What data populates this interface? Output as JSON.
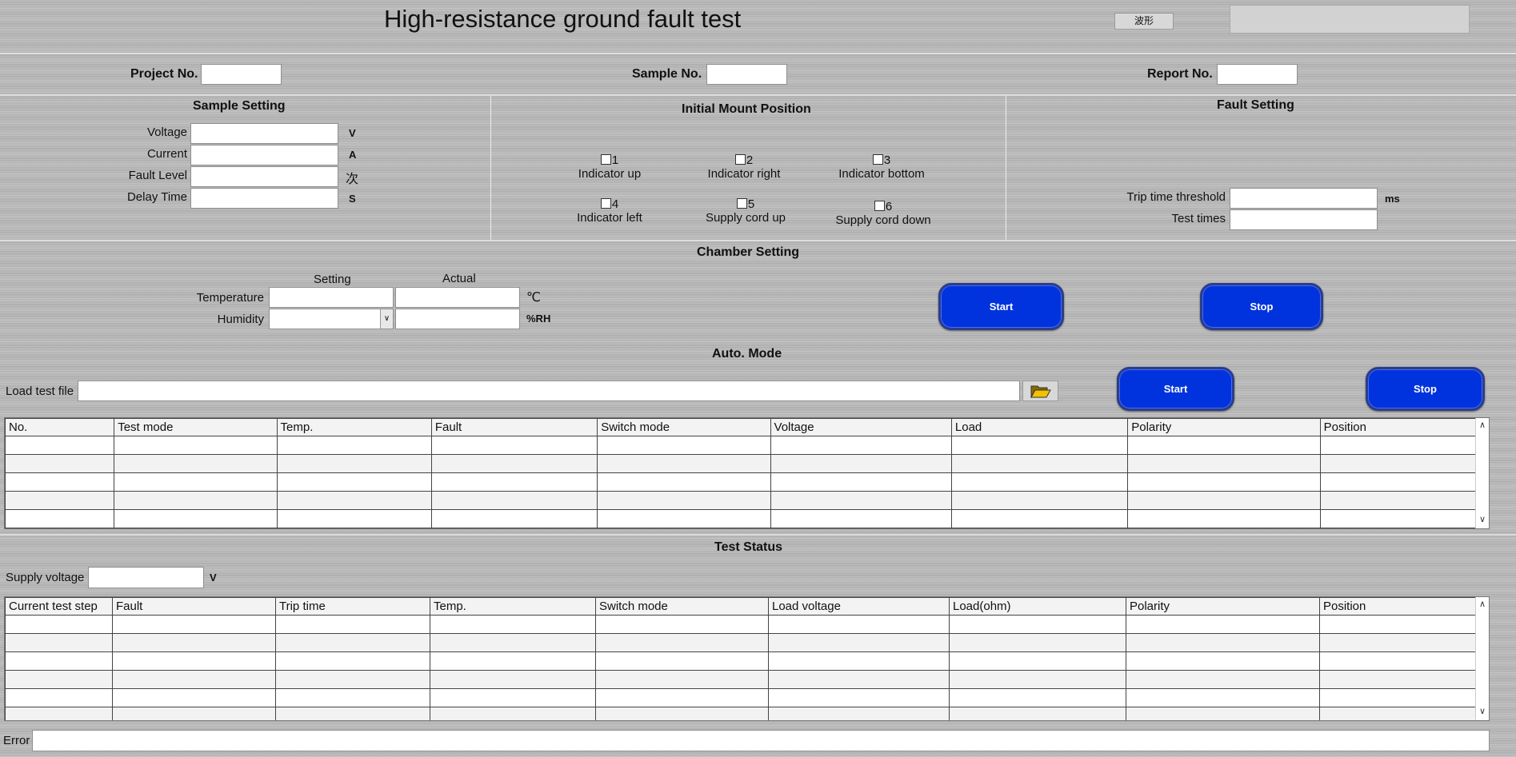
{
  "header": {
    "title": "High-resistance ground fault test",
    "wave_button_label": "波形"
  },
  "info": {
    "project_label": "Project No.",
    "sample_label": "Sample No.",
    "report_label": "Report No."
  },
  "sample_setting": {
    "title": "Sample Setting",
    "voltage_label": "Voltage",
    "voltage_unit": "V",
    "current_label": "Current",
    "current_unit": "A",
    "fault_level_label": "Fault Level",
    "fault_level_unit": "次",
    "delay_time_label": "Delay Time",
    "delay_time_unit": "S"
  },
  "mount": {
    "title": "Initial Mount Position",
    "positions": [
      {
        "number": "1",
        "label": "Indicator up"
      },
      {
        "number": "2",
        "label": "Indicator right"
      },
      {
        "number": "3",
        "label": "Indicator bottom"
      },
      {
        "number": "4",
        "label": "Indicator left"
      },
      {
        "number": "5",
        "label": "Supply cord up"
      },
      {
        "number": "6",
        "label": "Supply cord down"
      }
    ]
  },
  "fault_setting": {
    "title": "Fault Setting",
    "trip_threshold_label": "Trip time threshold",
    "trip_threshold_unit": "ms",
    "test_times_label": "Test times"
  },
  "chamber": {
    "title": "Chamber Setting",
    "setting_header": "Setting",
    "actual_header": "Actual",
    "temperature_label": "Temperature",
    "temperature_unit": "℃",
    "humidity_label": "Humidity",
    "humidity_unit": "%RH",
    "start_label": "Start",
    "stop_label": "Stop"
  },
  "auto_mode": {
    "title": "Auto. Mode",
    "load_file_label": "Load test file",
    "start_label": "Start",
    "stop_label": "Stop",
    "columns": [
      "No.",
      "Test mode",
      "Temp.",
      "Fault",
      "Switch mode",
      "Voltage",
      "Load",
      "Polarity",
      "Position"
    ]
  },
  "test_status": {
    "title": "Test Status",
    "supply_voltage_label": "Supply voltage",
    "supply_voltage_unit": "V",
    "columns": [
      "Current test step",
      "Fault",
      "Trip time",
      "Temp.",
      "Switch mode",
      "Load voltage",
      "Load(ohm)",
      "Polarity",
      "Position"
    ]
  },
  "error": {
    "label": "Error"
  },
  "icons": {
    "folder": "folder-open-icon",
    "dropdown": "chevron-down-icon",
    "scroll_up": "scroll-up-icon",
    "scroll_down": "scroll-down-icon"
  },
  "colors": {
    "button_blue": "#0033dd",
    "background": "#b9b9b9"
  }
}
